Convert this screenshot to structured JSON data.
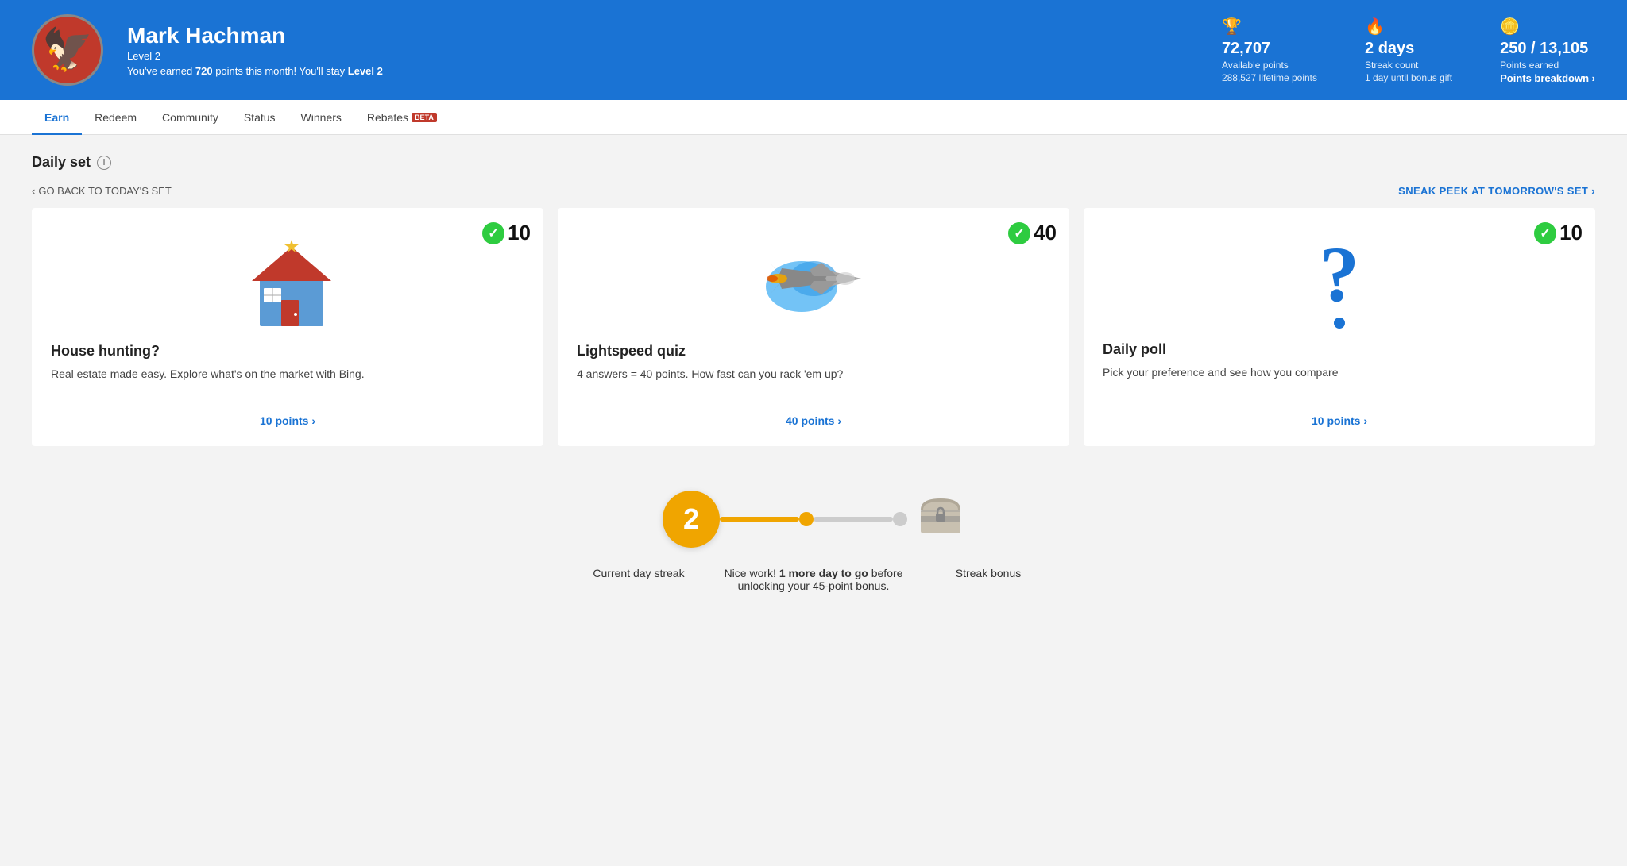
{
  "header": {
    "user": {
      "name": "Mark Hachman",
      "level": "Level 2",
      "status": "You've earned",
      "earned_points": "720",
      "status_suffix": "points this month! You'll stay",
      "stay_level": "Level 2"
    },
    "stats": {
      "points": {
        "icon": "🏆",
        "main": "72,707",
        "label": "Available points",
        "sub": "288,527 lifetime points"
      },
      "streak": {
        "icon": "🔥",
        "main": "2 days",
        "label": "Streak count",
        "sub": "1 day until bonus gift"
      },
      "earned": {
        "icon": "🪙",
        "main": "250 / 13,105",
        "label": "Points earned",
        "link": "Points breakdown ›"
      }
    }
  },
  "nav": {
    "items": [
      {
        "label": "Earn",
        "active": true
      },
      {
        "label": "Redeem",
        "active": false
      },
      {
        "label": "Community",
        "active": false
      },
      {
        "label": "Status",
        "active": false
      },
      {
        "label": "Winners",
        "active": false
      },
      {
        "label": "Rebates",
        "active": false,
        "badge": "BETA"
      }
    ]
  },
  "main": {
    "section_title": "Daily set",
    "back_label": "GO BACK TO TODAY'S SET",
    "forward_label": "SNEAK PEEK AT TOMORROW'S SET",
    "cards": [
      {
        "id": "card-house",
        "points": "10",
        "title": "House hunting?",
        "desc": "Real estate made easy. Explore what's on the market with Bing.",
        "points_link": "10 points ›",
        "completed": true
      },
      {
        "id": "card-quiz",
        "points": "40",
        "title": "Lightspeed quiz",
        "desc": "4 answers = 40 points. How fast can you rack 'em up?",
        "points_link": "40 points ›",
        "completed": true
      },
      {
        "id": "card-poll",
        "points": "10",
        "title": "Daily poll",
        "desc": "Pick your preference and see how you compare",
        "points_link": "10 points ›",
        "completed": true
      }
    ]
  },
  "streak": {
    "current_number": "2",
    "label_current": "Current day streak",
    "label_middle": "Nice work!",
    "label_middle_bold": "1 more day to go",
    "label_middle_suffix": "before unlocking your 45-point bonus.",
    "label_bonus": "Streak bonus"
  }
}
